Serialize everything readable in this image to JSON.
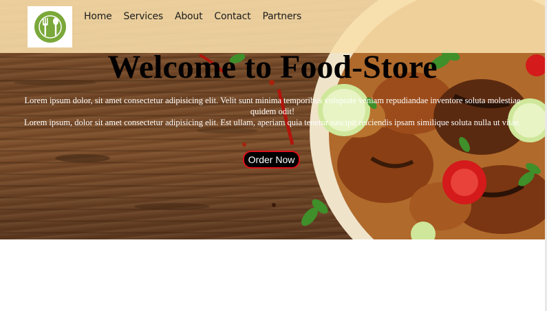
{
  "nav": {
    "logo_icon": "utensils-plate-icon",
    "items": [
      "Home",
      "Services",
      "About",
      "Contact",
      "Partners"
    ]
  },
  "hero": {
    "title": "Welcome to Food-Store",
    "paragraph_1": "Lorem ipsum dolor, sit amet consectetur adipisicing elit. Velit sunt minima temporibus voluptate veniam repudiandae inventore soluta molestiae quidem odit!",
    "paragraph_2": "Lorem ipsum, dolor sit amet consectetur adipisicing elit. Est ullam, aperiam quia tenetur suscipit reiciendis ipsam similique soluta nulla ut vitae.",
    "button_label": "Order Now"
  },
  "colors": {
    "navbar_bg": "#f8deaa",
    "logo_green": "#7aa83a",
    "button_border": "#e0101a"
  }
}
